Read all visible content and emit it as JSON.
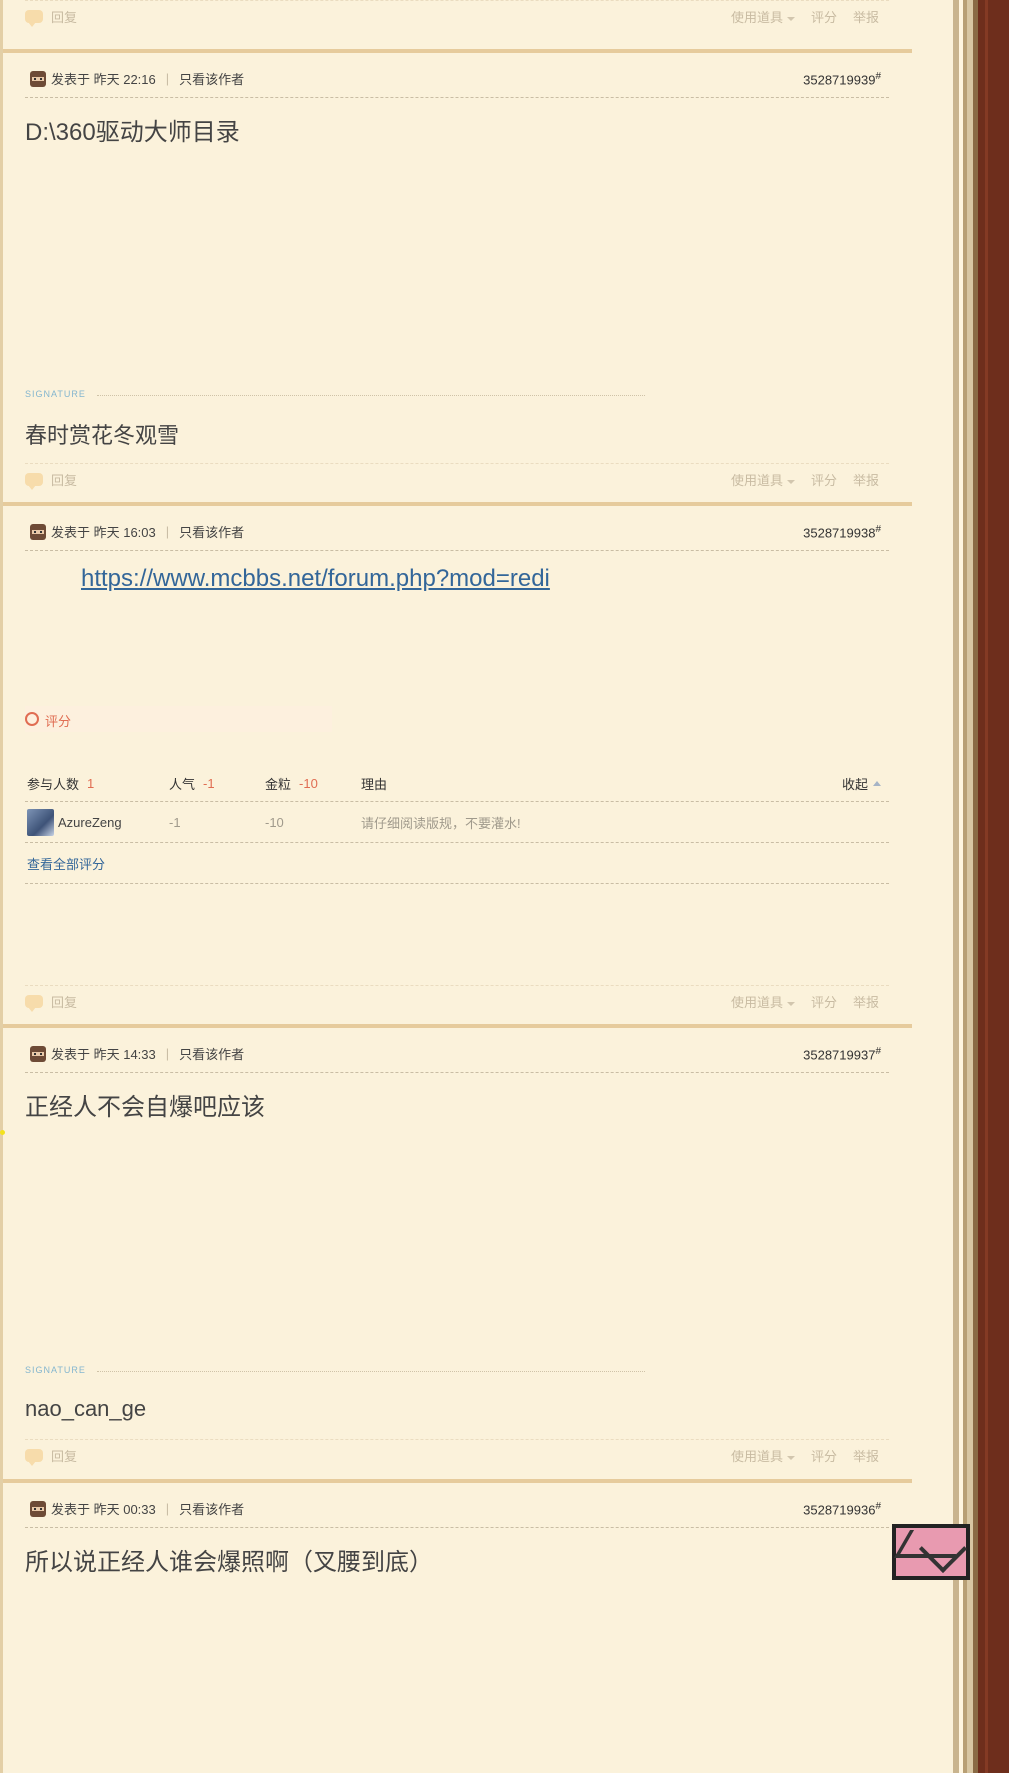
{
  "actions": {
    "reply": "回复",
    "tools": "使用道具",
    "rate": "评分",
    "report": "举报"
  },
  "posts": [
    {
      "posted": "发表于 昨天 22:16",
      "author_only": "只看该作者",
      "number": "3528719939",
      "content": "D:\\360驱动大师目录",
      "signature_label": "SIGNATURE",
      "signature": "春时赏花冬观雪"
    },
    {
      "posted": "发表于 昨天 16:03",
      "author_only": "只看该作者",
      "number": "3528719938",
      "link": "https://www.mcbbs.net/forum.php?mod=redi",
      "rating": {
        "title": "评分",
        "col_participants": "参与人数",
        "participants": "1",
        "col_popularity": "人气",
        "popularity": "-1",
        "col_nuggets": "金粒",
        "nuggets": "-10",
        "col_reason": "理由",
        "collapse": "收起",
        "rows": [
          {
            "user": "AzureZeng",
            "popularity": "-1",
            "nuggets": "-10",
            "reason": "请仔细阅读版规，不要灌水!"
          }
        ],
        "view_all": "查看全部评分"
      }
    },
    {
      "posted": "发表于 昨天 14:33",
      "author_only": "只看该作者",
      "number": "3528719937",
      "content": "正经人不会自爆吧应该",
      "signature_label": "SIGNATURE",
      "signature": "nao_can_ge"
    },
    {
      "posted": "发表于 昨天 00:33",
      "author_only": "只看该作者",
      "number": "3528719936",
      "content": "所以说正经人谁会爆照啊（叉腰到底）"
    }
  ],
  "post_suffix": "#"
}
